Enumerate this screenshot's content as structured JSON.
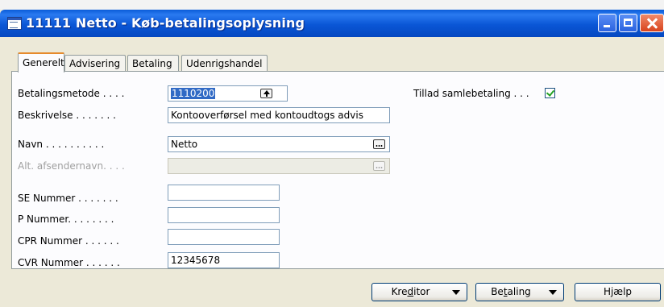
{
  "window": {
    "title": "11111 Netto - Køb-betalingsoplysning",
    "icon": "card-form-icon"
  },
  "tabs": [
    {
      "label": "Generelt",
      "active": true
    },
    {
      "label": "Advisering",
      "active": false
    },
    {
      "label": "Betaling",
      "active": false
    },
    {
      "label": "Udenrigshandel",
      "active": false
    }
  ],
  "form": {
    "betalingsmetode": {
      "label": "Betalingsmetode . . . .",
      "value": "1110200"
    },
    "beskrivelse": {
      "label": "Beskrivelse . . . . . . .",
      "value": "Kontooverførsel med kontoudtogs advis"
    },
    "navn": {
      "label": "Navn . . . . . . . . . .",
      "value": "Netto"
    },
    "alt_afsendernavn": {
      "label": "Alt. afsendernavn. . . .",
      "value": ""
    },
    "se_nummer": {
      "label": "SE Nummer . . . . . . .",
      "value": ""
    },
    "p_nummer": {
      "label": "P Nummer. . . . . . . .",
      "value": ""
    },
    "cpr_nummer": {
      "label": "CPR Nummer . . . . . .",
      "value": ""
    },
    "cvr_nummer": {
      "label": "CVR Nummer . . . . . .",
      "value": "12345678"
    },
    "tillad_samlebetaling": {
      "label": "Tillad samlebetaling . . .",
      "checked": true
    }
  },
  "buttons": {
    "kreditor": {
      "pre": "Kre",
      "u": "d",
      "post": "itor"
    },
    "betaling": {
      "pre": "Be",
      "u": "t",
      "post": "aling"
    },
    "hjaelp": {
      "label": "Hjælp"
    }
  }
}
